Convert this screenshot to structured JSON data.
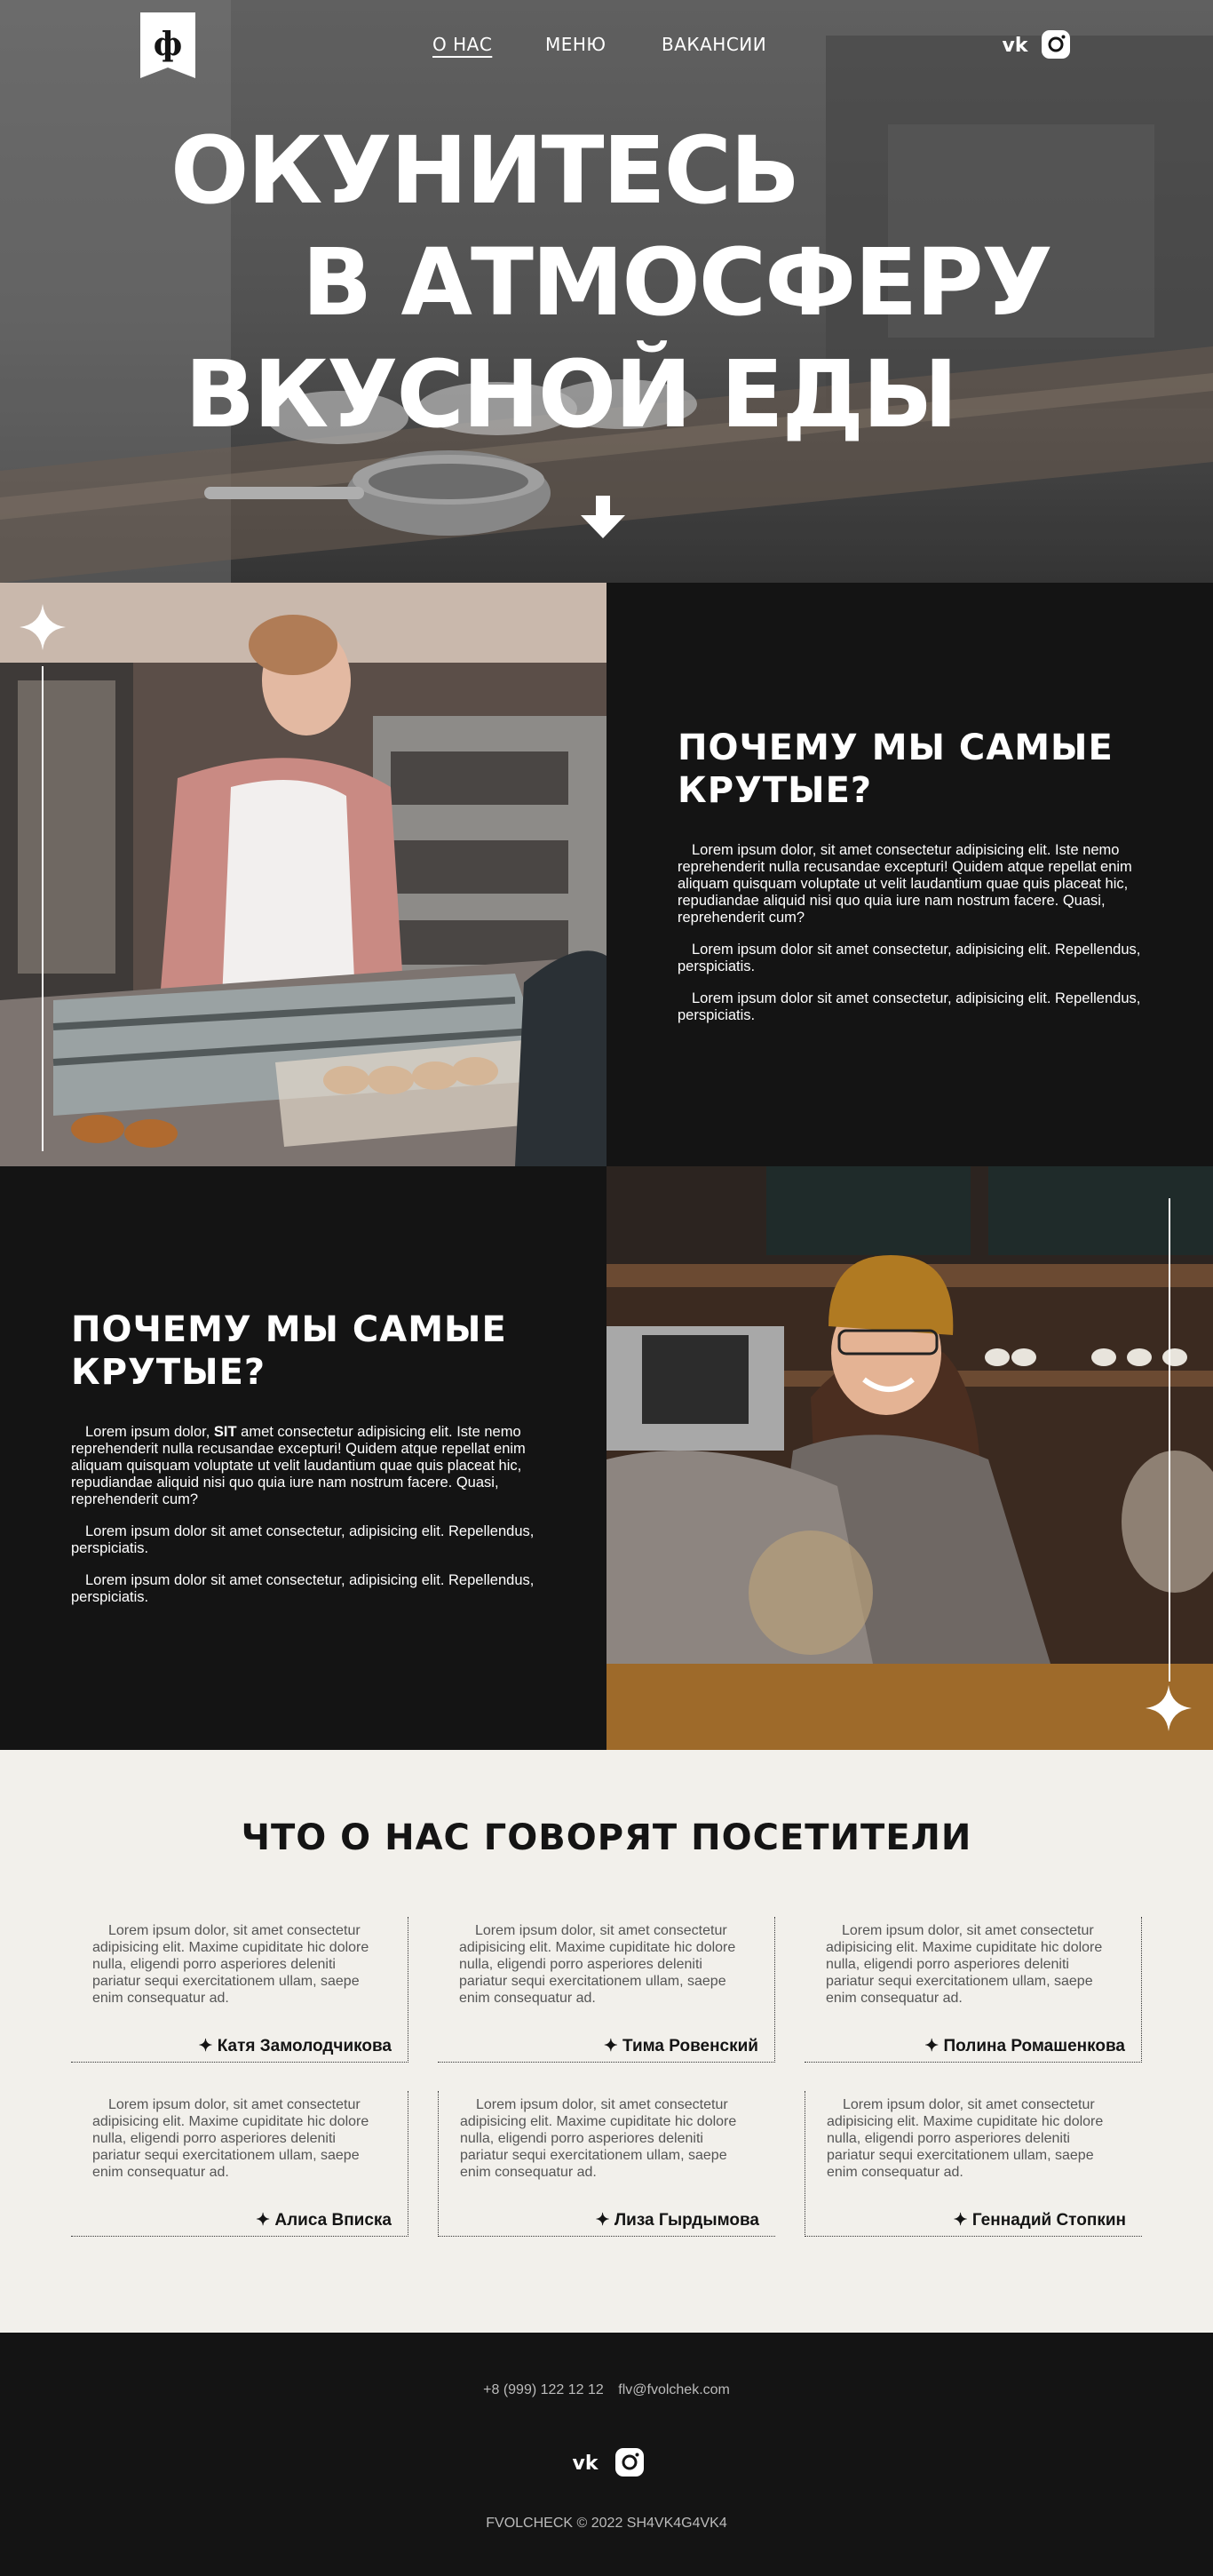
{
  "nav": {
    "items": [
      {
        "label": "О НАС",
        "active": true
      },
      {
        "label": "МЕНЮ",
        "active": false
      },
      {
        "label": "ВАКАНСИИ",
        "active": false
      }
    ]
  },
  "hero": {
    "lines": [
      "ОКУНИТЕСЬ",
      "В АТМОСФЕРУ",
      "ВКУСНОЙ ЕДЫ"
    ]
  },
  "feature1": {
    "title": "ПОЧЕМУ МЫ САМЫЕ КРУТЫЕ?",
    "paragraphs": [
      "Lorem ipsum dolor, sit amet consectetur adipisicing elit. Iste nemo reprehenderit nulla recusandae excepturi! Quidem atque repellat enim aliquam quisquam voluptate ut velit laudantium quae quis placeat hic, repudiandae aliquid nisi quo quia iure nam nostrum facere. Quasi, reprehenderit cum?",
      "Lorem ipsum dolor sit amet consectetur, adipisicing elit. Repellendus, perspiciatis.",
      "Lorem ipsum dolor sit amet consectetur, adipisicing elit. Repellendus, perspiciatis."
    ]
  },
  "feature2": {
    "title": "ПОЧЕМУ МЫ САМЫЕ КРУТЫЕ?",
    "p1_before": "Lorem ipsum dolor, ",
    "p1_bold": "SIT",
    "p1_after": " amet consectetur adipisicing elit. Iste nemo reprehenderit nulla recusandae excepturi! Quidem atque repellat enim aliquam quisquam voluptate ut velit laudantium quae quis placeat hic, repudiandae aliquid nisi quo quia iure nam nostrum facere. Quasi, reprehenderit cum?",
    "paragraphs": [
      "Lorem ipsum dolor sit amet consectetur, adipisicing elit. Repellendus, perspiciatis.",
      "Lorem ipsum dolor sit amet consectetur, adipisicing elit. Repellendus, perspiciatis."
    ]
  },
  "reviews": {
    "title": "ЧТО О НАС ГОВОРЯТ ПОСЕТИТЕЛИ",
    "text": "Lorem ipsum dolor, sit amet consectetur adipisicing elit. Maxime cupiditate hic dolore nulla, eligendi porro asperiores deleniti pariatur sequi exercitationem ullam, saepe enim consequatur ad.",
    "items": [
      {
        "author": "✦ Катя Замолодчикова"
      },
      {
        "author": "✦ Тима Ровенский"
      },
      {
        "author": "✦ Полина Ромашенкова"
      },
      {
        "author": "✦ Алиса Вписка"
      },
      {
        "author": "✦ Лиза Гырдымова"
      },
      {
        "author": "✦ Геннадий Стопкин"
      }
    ]
  },
  "footer": {
    "phone": "+8 (999) 122 12 12",
    "email": "flv@fvolchek.com",
    "copyright": "FVOLCHECK © 2022 SH4VK4G4VK4"
  },
  "icons": {
    "logo": "phi-logo-icon",
    "vk": "vk-icon",
    "instagram": "instagram-icon",
    "arrow": "arrow-down-icon",
    "sparkle": "sparkle-icon"
  },
  "colors": {
    "dark": "#141414",
    "light": "#f2f0eb",
    "text": "#ffffff"
  }
}
